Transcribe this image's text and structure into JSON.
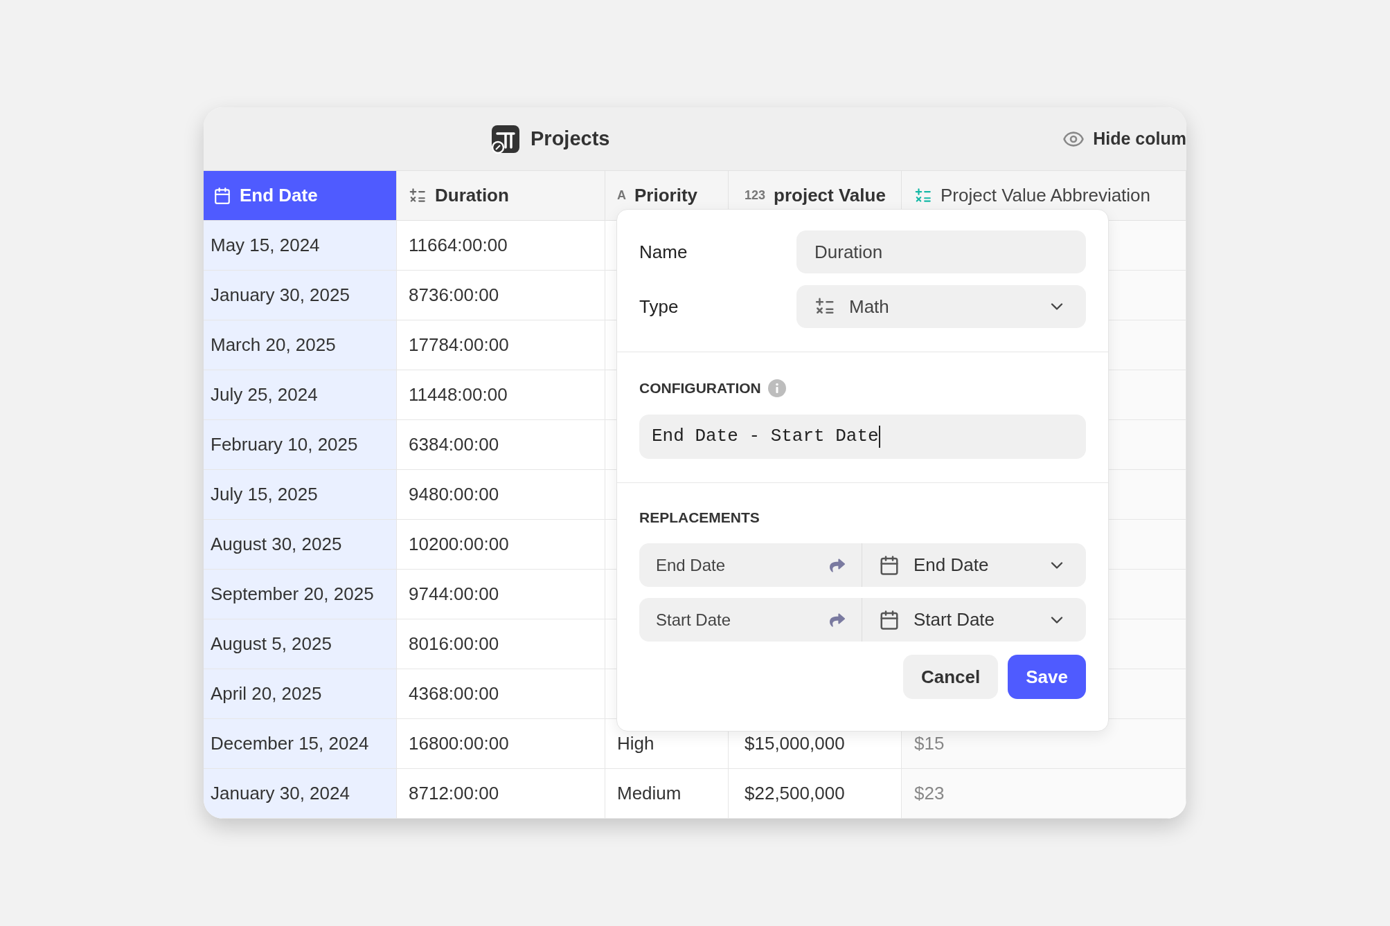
{
  "header": {
    "title": "Projects",
    "hide_columns": "Hide colum"
  },
  "table": {
    "columns": [
      {
        "label": "End Date",
        "kind": "date",
        "selected": true
      },
      {
        "label": "Duration",
        "kind": "math",
        "selected": false
      },
      {
        "label": "Priority",
        "kind": "text",
        "icon_text": "A",
        "selected": false
      },
      {
        "label": "project Value",
        "kind": "number",
        "icon_text": "123",
        "selected": false
      },
      {
        "label": "Project Value Abbreviation",
        "kind": "math",
        "muted": true,
        "selected": false
      }
    ],
    "rows": [
      {
        "cells": [
          "May 15, 2024",
          "11664:00:00"
        ]
      },
      {
        "cells": [
          "January 30, 2025",
          "8736:00:00"
        ]
      },
      {
        "cells": [
          "March 20, 2025",
          "17784:00:00"
        ]
      },
      {
        "cells": [
          "July 25, 2024",
          "11448:00:00"
        ]
      },
      {
        "cells": [
          "February 10, 2025",
          "6384:00:00"
        ]
      },
      {
        "cells": [
          "July 15, 2025",
          "9480:00:00"
        ]
      },
      {
        "cells": [
          "August 30, 2025",
          "10200:00:00"
        ]
      },
      {
        "cells": [
          "September 20, 2025",
          "9744:00:00"
        ]
      },
      {
        "cells": [
          "August 5, 2025",
          "8016:00:00"
        ]
      },
      {
        "cells": [
          "April 20, 2025",
          "4368:00:00"
        ]
      },
      {
        "cells": [
          "December 15, 2024",
          "16800:00:00",
          "High",
          "$15,000,000",
          "$15"
        ]
      },
      {
        "cells": [
          "January 30, 2024",
          "8712:00:00",
          "Medium",
          "$22,500,000",
          "$23"
        ]
      }
    ]
  },
  "editor": {
    "name_label": "Name",
    "name_value": "Duration",
    "type_label": "Type",
    "type_value": "Math",
    "config_heading": "CONFIGURATION",
    "formula": "End Date - Start Date",
    "replacements_heading": "REPLACEMENTS",
    "replacements": [
      {
        "variable": "End Date",
        "field": "End Date"
      },
      {
        "variable": "Start Date",
        "field": "Start Date"
      }
    ],
    "buttons": [
      {
        "label": "Cancel",
        "kind": "secondary"
      },
      {
        "label": "Save",
        "kind": "primary"
      }
    ]
  }
}
